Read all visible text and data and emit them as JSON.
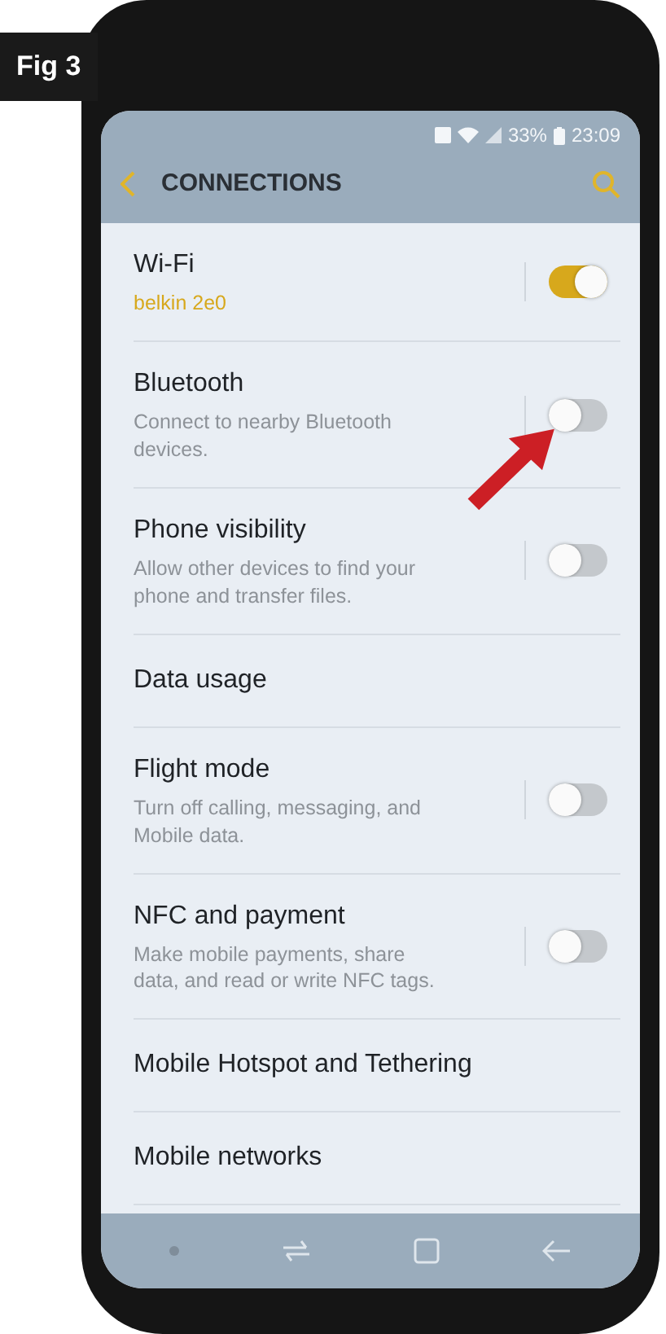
{
  "figure_label": "Fig 3",
  "status_bar": {
    "battery": "33%",
    "time": "23:09"
  },
  "header": {
    "title": "CONNECTIONS"
  },
  "items": [
    {
      "kind": "toggle",
      "title": "Wi-Fi",
      "status": "belkin 2e0",
      "on": true
    },
    {
      "kind": "toggle",
      "title": "Bluetooth",
      "description": "Connect to nearby Bluetooth devices.",
      "on": false
    },
    {
      "kind": "toggle",
      "title": "Phone visibility",
      "description": "Allow other devices to find your phone and transfer files.",
      "on": false
    },
    {
      "kind": "link",
      "title": "Data usage"
    },
    {
      "kind": "toggle",
      "title": "Flight mode",
      "description": "Turn off calling, messaging, and Mobile data.",
      "on": false
    },
    {
      "kind": "toggle",
      "title": "NFC and payment",
      "description": "Make mobile payments, share data, and read or write NFC tags.",
      "on": false
    },
    {
      "kind": "link",
      "title": "Mobile Hotspot and Tethering"
    },
    {
      "kind": "link",
      "title": "Mobile networks"
    }
  ]
}
